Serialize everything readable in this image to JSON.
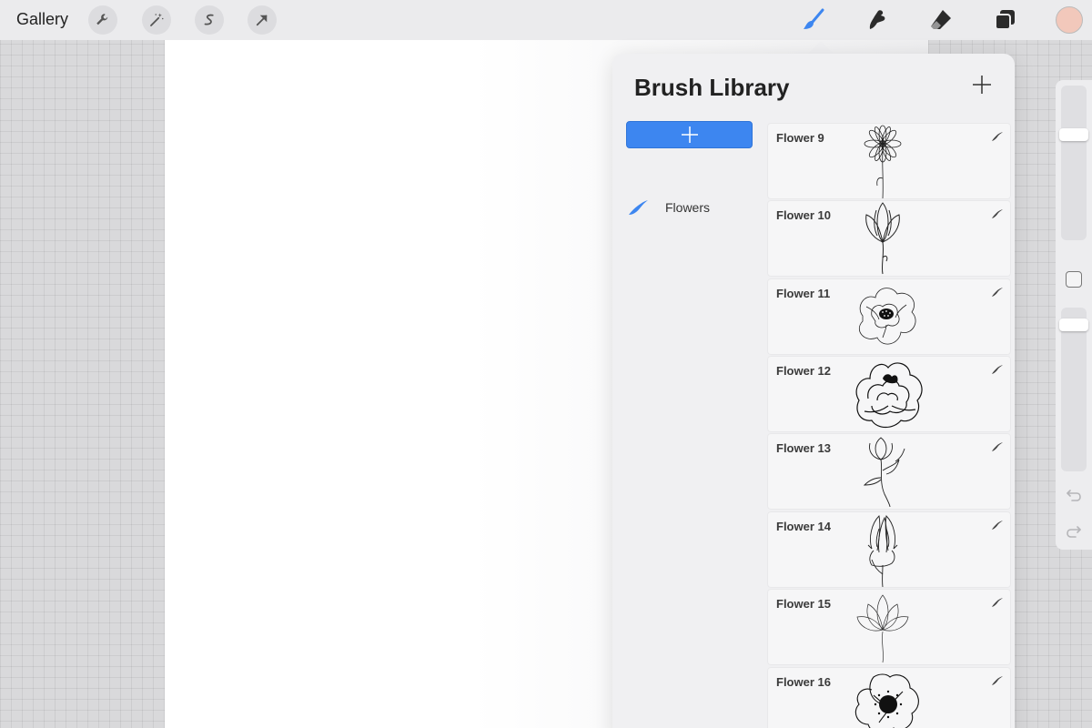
{
  "toolbar": {
    "gallery_label": "Gallery",
    "left_tools": [
      {
        "icon": "wrench-icon"
      },
      {
        "icon": "magic-wand-icon"
      },
      {
        "icon": "selection-icon"
      },
      {
        "icon": "transform-arrow-icon"
      }
    ],
    "right_tools": [
      {
        "icon": "brush-icon",
        "active": true
      },
      {
        "icon": "smudge-icon"
      },
      {
        "icon": "eraser-icon"
      },
      {
        "icon": "layers-icon"
      }
    ],
    "current_color": "#f2c8bb"
  },
  "brush_library": {
    "title": "Brush Library",
    "sets": [
      {
        "label": "Flowers",
        "icon": "brush-stroke-icon",
        "accent": "#3d86f0"
      }
    ],
    "brushes": [
      {
        "name": "Flower 9",
        "preview": "daisy-icon"
      },
      {
        "name": "Flower 10",
        "preview": "tulip-icon"
      },
      {
        "name": "Flower 11",
        "preview": "rose-icon"
      },
      {
        "name": "Flower 12",
        "preview": "peony-icon"
      },
      {
        "name": "Flower 13",
        "preview": "rosebud-icon"
      },
      {
        "name": "Flower 14",
        "preview": "protea-icon"
      },
      {
        "name": "Flower 15",
        "preview": "lotus-icon"
      },
      {
        "name": "Flower 16",
        "preview": "anemone-icon"
      }
    ]
  },
  "colors": {
    "accent_blue": "#3d86f0",
    "toolbar_bg": "#ebebed",
    "panel_bg": "#f0f0f2"
  }
}
